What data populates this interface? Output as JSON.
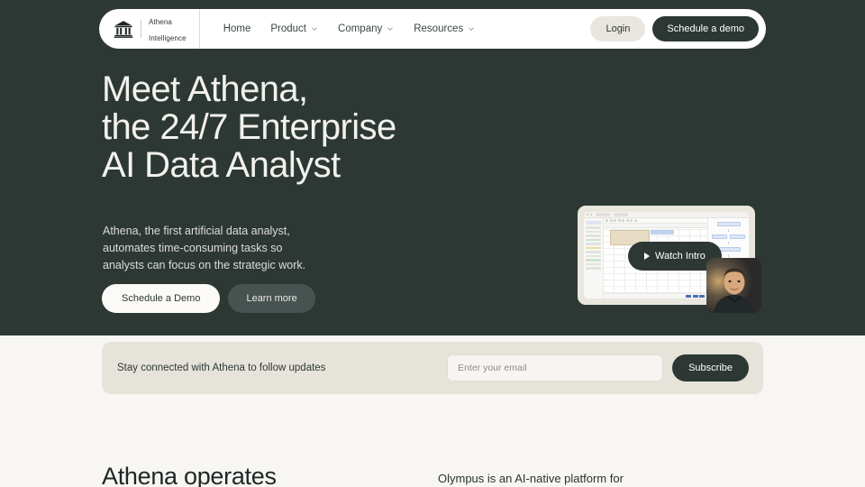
{
  "colors": {
    "hero_bg": "#2D3835",
    "page_bg": "#F7F6F2",
    "nav_pill_bg": "#FFFFFF",
    "newsletter_bg": "#E6E3DA",
    "login_btn_bg": "#E8E6DF",
    "dark_btn_bg": "#2D3835",
    "primary_btn_bg": "#FBFAF6",
    "ghost_btn_bg": "#475350",
    "video_card_bg": "#E9E6DE"
  },
  "nav": {
    "logo_icon": "bank-building-icon",
    "brand_line1": "Athena",
    "brand_line2": "Intelligence",
    "links": [
      {
        "label": "Home",
        "has_chevron": false
      },
      {
        "label": "Product",
        "has_chevron": true,
        "chevron_icon": "chevron-down-icon"
      },
      {
        "label": "Company",
        "has_chevron": true,
        "chevron_icon": "chevron-down-icon"
      },
      {
        "label": "Resources",
        "has_chevron": true,
        "chevron_icon": "chevron-down-icon"
      }
    ],
    "login_label": "Login",
    "demo_label": "Schedule a demo"
  },
  "hero": {
    "heading": "Meet Athena,\nthe 24/7 Enterprise\nAI Data Analyst",
    "subtext": "Athena, the first artificial data analyst,\nautomates time-consuming tasks so\nanalysts can focus on the strategic work.",
    "primary_cta": "Schedule a Demo",
    "secondary_cta": "Learn more"
  },
  "video": {
    "watch_label": "Watch Intro",
    "play_icon": "play-triangle-icon",
    "thumbnail_alt": "product-screenshot-spreadsheet-and-flowchart",
    "presenter_alt": "presenter-video-thumbnail"
  },
  "newsletter": {
    "text": "Stay connected with Athena to follow updates",
    "email_placeholder": "Enter your email",
    "email_value": "",
    "subscribe_label": "Subscribe"
  },
  "next_section": {
    "title": "Athena operates",
    "body": "Olympus is an AI-native platform for"
  }
}
